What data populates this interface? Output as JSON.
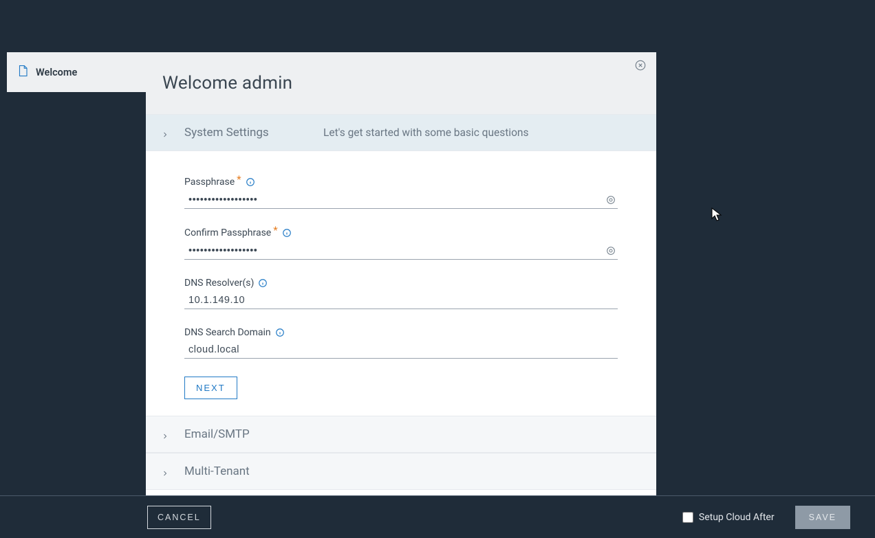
{
  "sidebar": {
    "tab_label": "Welcome"
  },
  "dialog": {
    "title": "Welcome admin",
    "sections": {
      "system": {
        "title": "System Settings",
        "subtitle": "Let's get started with some basic questions"
      },
      "email": {
        "title": "Email/SMTP"
      },
      "tenant": {
        "title": "Multi-Tenant"
      }
    },
    "fields": {
      "passphrase_label": "Passphrase",
      "passphrase_value": "••••••••••••••••••",
      "confirm_label": "Confirm Passphrase",
      "confirm_value": "••••••••••••••••••",
      "dns_label": "DNS Resolver(s)",
      "dns_value": "10.1.149.10",
      "search_label": "DNS Search Domain",
      "search_value": "cloud.local"
    },
    "next_label": "NEXT"
  },
  "footer": {
    "cancel_label": "CANCEL",
    "setup_cloud_label": "Setup Cloud After",
    "save_label": "SAVE"
  }
}
